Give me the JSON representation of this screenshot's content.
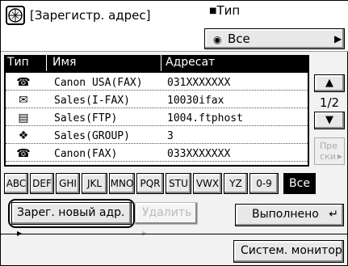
{
  "header": {
    "title": "[Зарегистр. адрес]",
    "type_label": "Тип",
    "type_value": "Все"
  },
  "columns": {
    "type": "Тип",
    "name": "Имя",
    "address": "Адресат"
  },
  "rows": [
    {
      "icon": "fax-icon",
      "name": "Canon USA(FAX)",
      "address": "031XXXXXXX"
    },
    {
      "icon": "ifax-icon",
      "name": "Sales(I-FAX)",
      "address": "10030ifax"
    },
    {
      "icon": "ftp-icon",
      "name": "Sales(FTP)",
      "address": "1004.ftphost"
    },
    {
      "icon": "group-icon",
      "name": "Sales(GROUP)",
      "address": "3"
    },
    {
      "icon": "fax-icon",
      "name": "Canon(FAX)",
      "address": "033XXXXXXX"
    }
  ],
  "pager": {
    "page": "1/2",
    "prev_label": "Пре\nски"
  },
  "letters": [
    "ABC",
    "DEF",
    "GHI",
    "JKL",
    "MNO",
    "PQR",
    "STU",
    "VWX",
    "YZ",
    "0-9",
    "Все"
  ],
  "actions": {
    "register_new": "Зарег. новый адр.",
    "delete": "Удалить",
    "done": "Выполнено",
    "system_monitor": "Систем. монитор"
  }
}
